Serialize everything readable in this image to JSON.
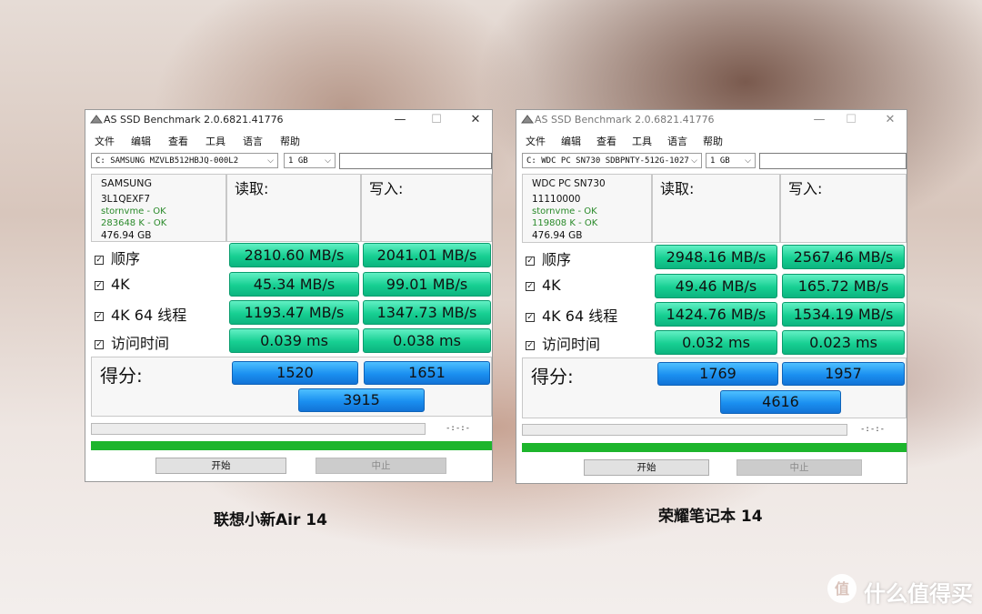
{
  "windows": [
    {
      "title": "AS SSD Benchmark 2.0.6821.41776",
      "menu": [
        "文件",
        "编辑",
        "查看",
        "工具",
        "语言",
        "帮助"
      ],
      "drive": "C: SAMSUNG MZVLB512HBJQ-000L2",
      "size": "1 GB",
      "info": [
        "SAMSUNG",
        "3L1QEXF7",
        "stornvme - OK",
        "283648 K - OK",
        "476.94 GB"
      ],
      "read_header": "读取:",
      "write_header": "写入:",
      "rows": [
        {
          "label": "顺序",
          "read": "2810.60 MB/s",
          "write": "2041.01 MB/s"
        },
        {
          "label": "4K",
          "read": "45.34 MB/s",
          "write": "99.01 MB/s"
        },
        {
          "label": "4K 64 线程",
          "read": "1193.47 MB/s",
          "write": "1347.73 MB/s"
        },
        {
          "label": "访问时间",
          "read": "0.039 ms",
          "write": "0.038 ms"
        }
      ],
      "score_label": "得分:",
      "score_read": "1520",
      "score_write": "1651",
      "score_total": "3915",
      "timer": "-:-:-",
      "start": "开始",
      "stop": "中止",
      "caption": "联想小新Air 14"
    },
    {
      "title": "AS SSD Benchmark 2.0.6821.41776",
      "menu": [
        "文件",
        "编辑",
        "查看",
        "工具",
        "语言",
        "帮助"
      ],
      "drive": "C: WDC PC SN730 SDBPNTY-512G-1027",
      "size": "1 GB",
      "info": [
        "WDC PC SN730",
        "11110000",
        "stornvme - OK",
        "119808 K - OK",
        "476.94 GB"
      ],
      "read_header": "读取:",
      "write_header": "写入:",
      "rows": [
        {
          "label": "顺序",
          "read": "2948.16 MB/s",
          "write": "2567.46 MB/s"
        },
        {
          "label": "4K",
          "read": "49.46 MB/s",
          "write": "165.72 MB/s"
        },
        {
          "label": "4K 64 线程",
          "read": "1424.76 MB/s",
          "write": "1534.19 MB/s"
        },
        {
          "label": "访问时间",
          "read": "0.032 ms",
          "write": "0.023 ms"
        }
      ],
      "score_label": "得分:",
      "score_read": "1769",
      "score_write": "1957",
      "score_total": "4616",
      "timer": "-:-:-",
      "start": "开始",
      "stop": "中止",
      "caption": "荣耀笔记本 14"
    }
  ],
  "watermark": "什么值得买",
  "colors": {
    "result_green": "#17cf92",
    "score_blue": "#1a8ff0",
    "progress_green": "#1db52c"
  }
}
